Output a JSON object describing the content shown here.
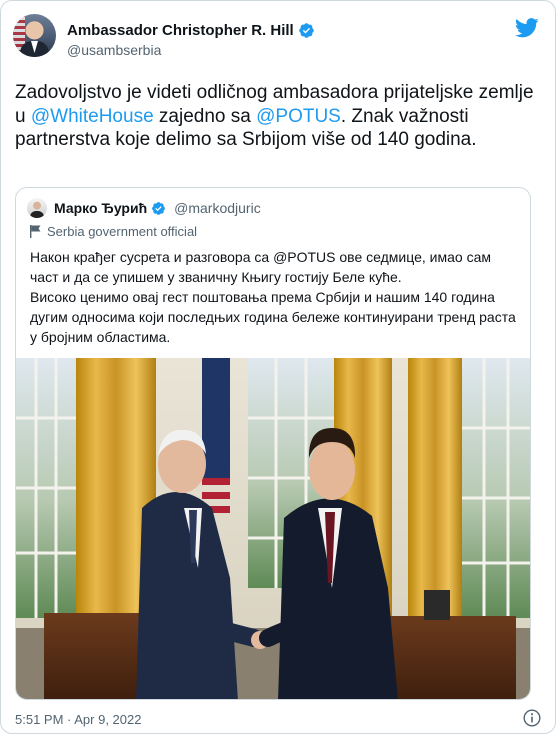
{
  "author": {
    "name": "Ambassador Christopher R. Hill",
    "handle": "@usambserbia",
    "verified": true
  },
  "tweet": {
    "segments": [
      {
        "text": "Zadovoljstvo je videti odličnog ambasadora prijateljske zemlje u ",
        "mention": false
      },
      {
        "text": "@WhiteHouse",
        "mention": true
      },
      {
        "text": " zajedno sa ",
        "mention": false
      },
      {
        "text": "@POTUS",
        "mention": true
      },
      {
        "text": ". Znak važnosti partnerstva koje delimo sa Srbijom više od 140 godina.",
        "mention": false
      }
    ]
  },
  "quote": {
    "name": "Марко Ђурић",
    "handle": "@markodjuric",
    "verified": true,
    "label": "Serbia government official",
    "paragraphs": [
      "Након крађег сусрета и разговора са @POTUS ове седмице, имао сам част и да се упишем у званичну Књигу гостију Беле куће.",
      "Високо ценимо овај гест поштовања према Србији и нашим 140 година дугим односима који последњих година бележе континуирани тренд раста у бројним областима."
    ]
  },
  "footer": {
    "timestamp": "5:51 PM · Apr 9, 2022"
  },
  "colors": {
    "accent": "#1d9bf0",
    "secondary_text": "#536471",
    "border": "#cfd9de"
  },
  "icons": [
    "verified-badge-icon",
    "twitter-bird-icon",
    "flag-icon",
    "info-icon"
  ]
}
